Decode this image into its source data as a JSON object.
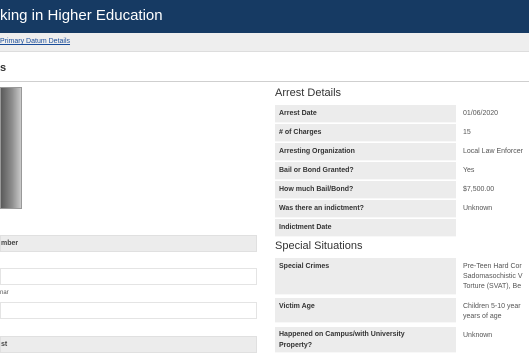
{
  "header": {
    "title": "king in Higher Education"
  },
  "breadcrumb": {
    "link": "Primary Datum Details"
  },
  "left": {
    "section_title": "s",
    "rows": [
      {
        "label": "mber"
      },
      {
        "label": ""
      },
      {
        "small": "nar"
      },
      {
        "label": ""
      },
      {
        "label": "st"
      }
    ]
  },
  "arrest": {
    "heading": "Arrest Details",
    "rows": [
      {
        "label": "Arrest Date",
        "value": "01/06/2020"
      },
      {
        "label": "# of Charges",
        "value": "15"
      },
      {
        "label": "Arresting Organization",
        "value": "Local Law Enforcer"
      },
      {
        "label": "Bail or Bond Granted?",
        "value": "Yes"
      },
      {
        "label": "How much Bail/Bond?",
        "value": "$7,500.00"
      },
      {
        "label": "Was there an indictment?",
        "value": "Unknown"
      },
      {
        "label": "Indictment Date",
        "value": ""
      }
    ]
  },
  "special": {
    "heading": "Special Situations",
    "crimes_label": "Special Crimes",
    "crimes_values": [
      "Pre-Teen Hard Cor",
      "Sadomasochistic V",
      "Torture (SVAT), Be"
    ],
    "age_label": "Victim Age",
    "age_values": [
      "Children 5-10 year",
      "years of age"
    ],
    "campus_label_lines": [
      "Happened on Campus/with University",
      "Property?"
    ],
    "campus_value": "Unknown"
  }
}
